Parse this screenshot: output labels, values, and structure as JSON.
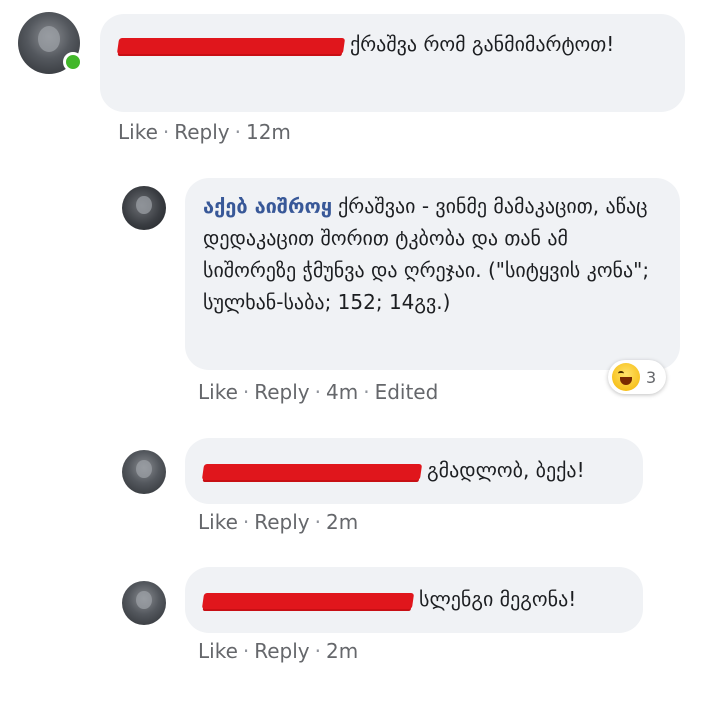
{
  "comments": [
    {
      "author": "",
      "text": "ქრაშვა რომ განმიმარტოთ!",
      "actions": {
        "like": "Like",
        "reply": "Reply",
        "time": "12m"
      }
    },
    {
      "author": "აქებ აიშროყ",
      "text": "ქრაშვაი - ვინმე მამაკაცით, აწაც დედაკაცით შორით ტკბობა და თან ამ სიშორეზე ჭმუნვა და ღრეჯაი. (\"სიტყვის კონა\"; სულხან-საბა; 152; 14გვ.)",
      "actions": {
        "like": "Like",
        "reply": "Reply",
        "time": "4m",
        "edited": "Edited"
      },
      "reaction": {
        "icon": "haha-emoji-icon",
        "count": "3"
      }
    },
    {
      "author": "",
      "text": "გმადლობ, ბექა!",
      "actions": {
        "like": "Like",
        "reply": "Reply",
        "time": "2m"
      }
    },
    {
      "author": "",
      "text": "სლენგი მეგონა!",
      "actions": {
        "like": "Like",
        "reply": "Reply",
        "time": "2m"
      }
    }
  ]
}
